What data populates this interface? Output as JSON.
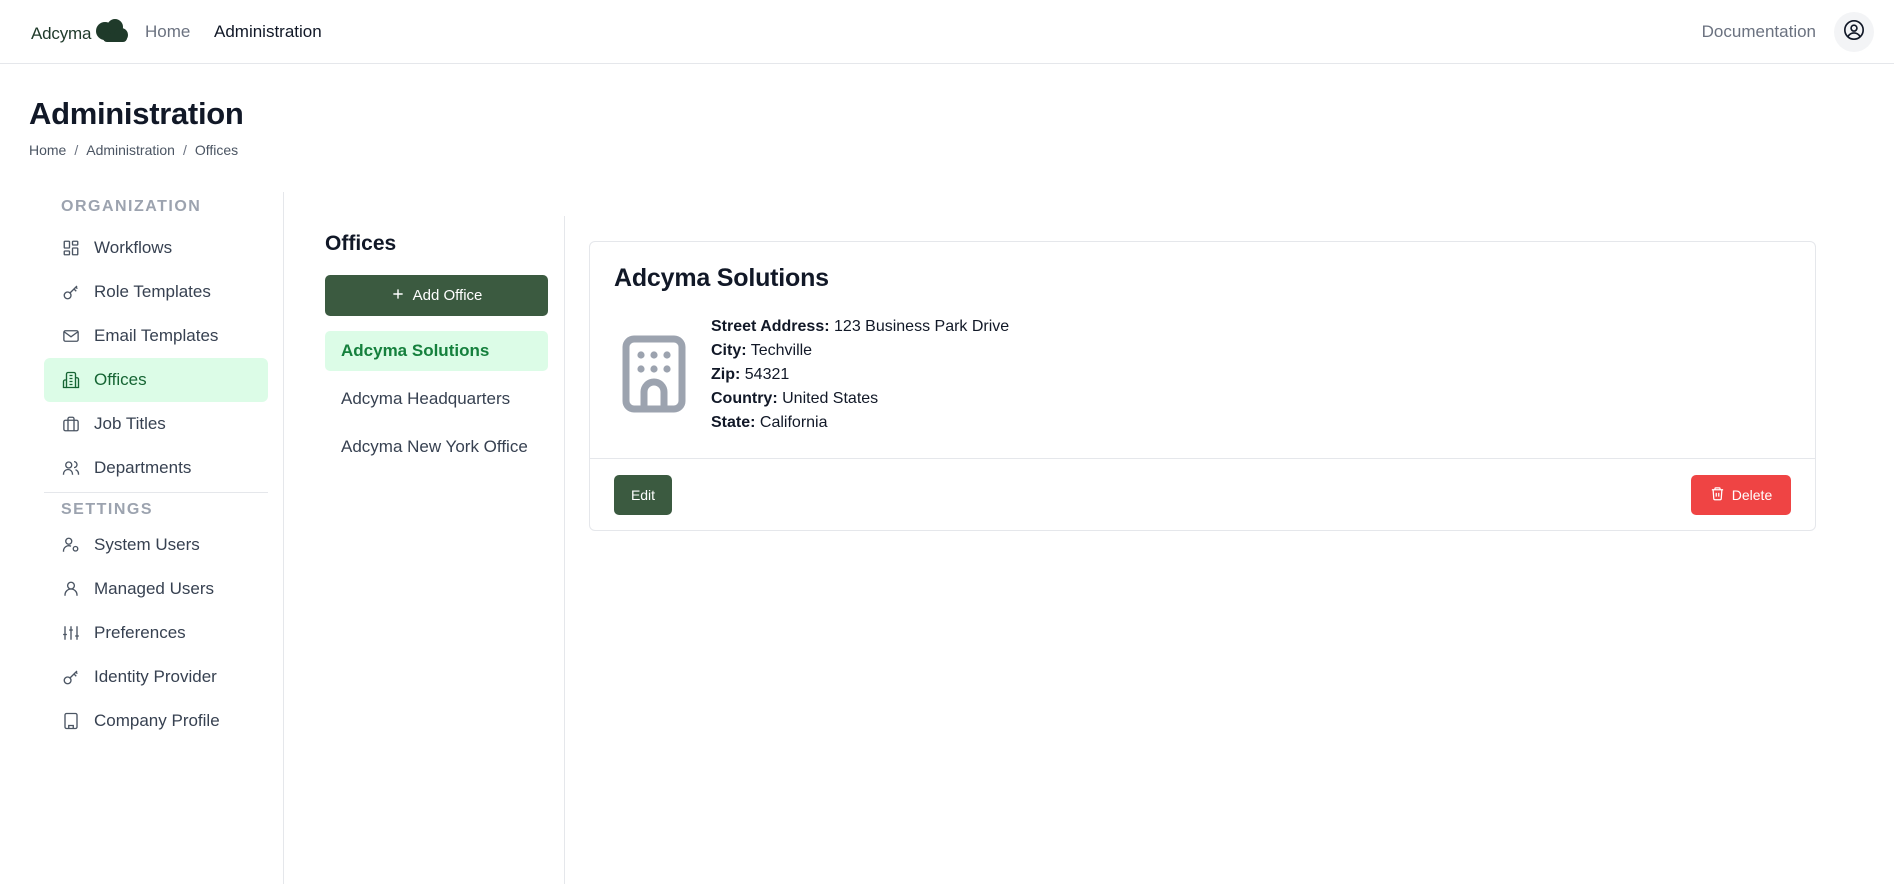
{
  "brand": {
    "name": "Adcyma",
    "color": "#1f3a2a"
  },
  "nav": {
    "home": "Home",
    "administration": "Administration",
    "documentation": "Documentation"
  },
  "page": {
    "title": "Administration"
  },
  "breadcrumb": [
    "Home",
    "Administration",
    "Offices"
  ],
  "sidebar": {
    "organization_label": "ORGANIZATION",
    "organization_items": [
      {
        "label": "Workflows",
        "icon": "grid-icon"
      },
      {
        "label": "Role Templates",
        "icon": "key-icon"
      },
      {
        "label": "Email Templates",
        "icon": "mail-icon"
      },
      {
        "label": "Offices",
        "icon": "building-icon",
        "active": true
      },
      {
        "label": "Job Titles",
        "icon": "briefcase-icon"
      },
      {
        "label": "Departments",
        "icon": "users-icon"
      }
    ],
    "settings_label": "SETTINGS",
    "settings_items": [
      {
        "label": "System Users",
        "icon": "user-gear-icon"
      },
      {
        "label": "Managed Users",
        "icon": "user-icon"
      },
      {
        "label": "Preferences",
        "icon": "sliders-icon"
      },
      {
        "label": "Identity Provider",
        "icon": "key-icon"
      },
      {
        "label": "Company Profile",
        "icon": "building-icon"
      }
    ]
  },
  "offices": {
    "title": "Offices",
    "add_label": "Add Office",
    "items": [
      "Adcyma Solutions",
      "Adcyma Headquarters",
      "Adcyma New York Office"
    ],
    "selected_index": 0
  },
  "detail": {
    "name": "Adcyma Solutions",
    "fields": [
      {
        "label": "Street Address:",
        "value": "123 Business Park Drive"
      },
      {
        "label": "City:",
        "value": "Techville"
      },
      {
        "label": "Zip:",
        "value": "54321"
      },
      {
        "label": "Country:",
        "value": "United States"
      },
      {
        "label": "State:",
        "value": "California"
      }
    ],
    "edit_label": "Edit",
    "delete_label": "Delete"
  },
  "colors": {
    "primary": "#3b5a40",
    "active_bg": "#dcfce7",
    "active_text": "#15803d",
    "danger": "#ef4444"
  }
}
